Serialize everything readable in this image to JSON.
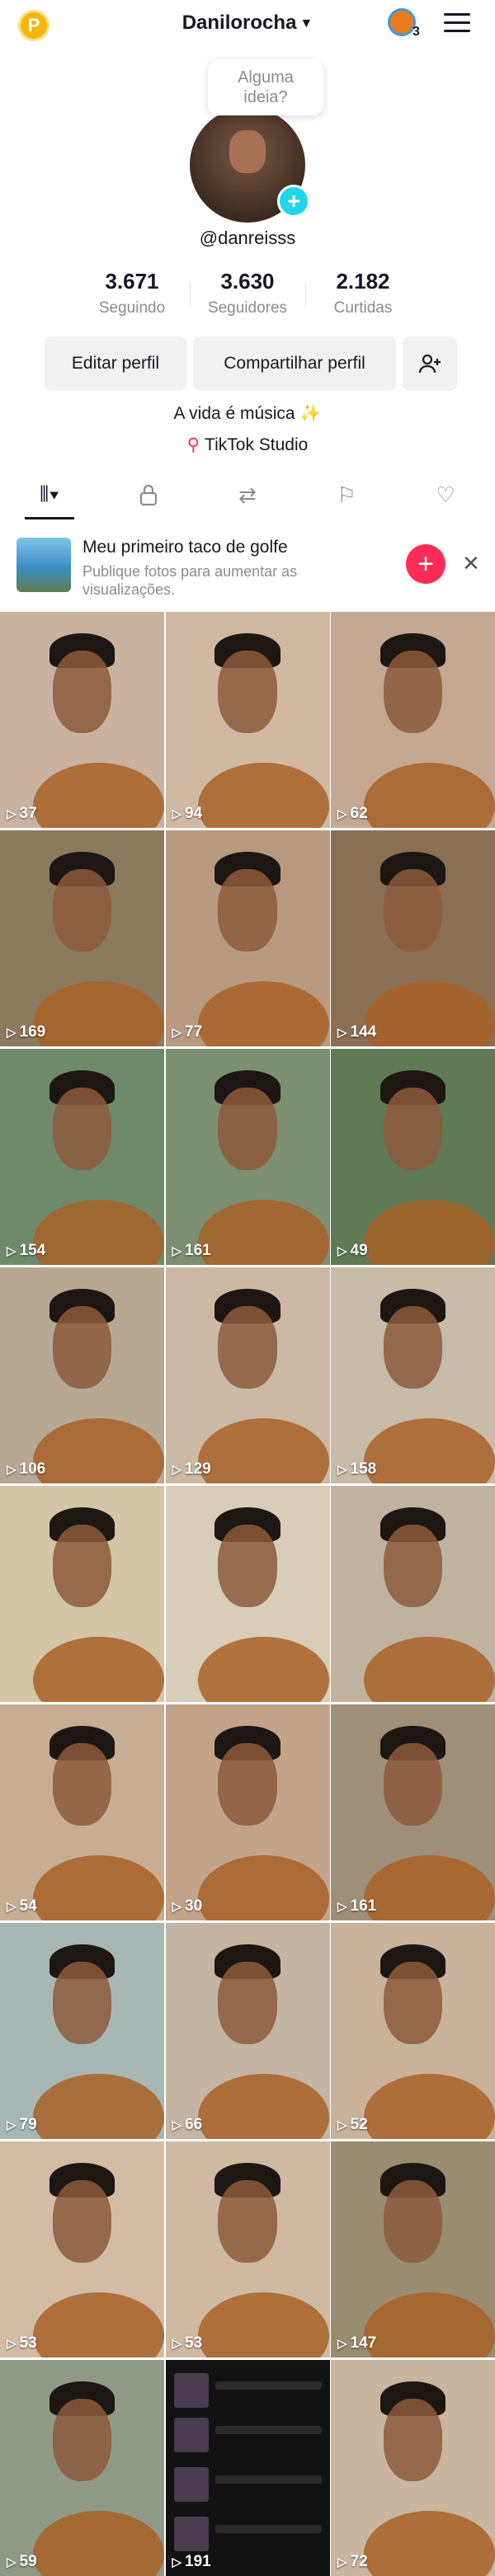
{
  "header": {
    "badge": "P",
    "title": "Danilorocha",
    "notification_count": "3"
  },
  "profile": {
    "tooltip": "Alguma ideia?",
    "handle": "@danreisss",
    "stats": [
      {
        "value": "3.671",
        "label": "Seguindo"
      },
      {
        "value": "3.630",
        "label": "Seguidores"
      },
      {
        "value": "2.182",
        "label": "Curtidas"
      }
    ],
    "edit_label": "Editar perfil",
    "share_label": "Compartilhar perfil",
    "bio": "A vida é música ✨",
    "studio_label": "TikTok Studio"
  },
  "tabs": [
    {
      "icon": "grid-icon",
      "active": true
    },
    {
      "icon": "lock-icon",
      "active": false
    },
    {
      "icon": "repost-icon",
      "active": false
    },
    {
      "icon": "bookmark-icon",
      "active": false
    },
    {
      "icon": "liked-icon",
      "active": false
    }
  ],
  "promo": {
    "title": "Meu primeiro taco de golfe",
    "subtitle": "Publique fotos para aumentar as visualizações."
  },
  "videos": [
    {
      "views": "37",
      "bg": "#c9b2a0"
    },
    {
      "views": "94",
      "bg": "#d1b8a3"
    },
    {
      "views": "62",
      "bg": "#c4a893"
    },
    {
      "views": "169",
      "bg": "#8c7a5e"
    },
    {
      "views": "77",
      "bg": "#b89a80"
    },
    {
      "views": "144",
      "bg": "#8a6f55"
    },
    {
      "views": "154",
      "bg": "#6f8a6a"
    },
    {
      "views": "161",
      "bg": "#7c8f70"
    },
    {
      "views": "49",
      "bg": "#5f7a55"
    },
    {
      "views": "106",
      "bg": "#b7a894"
    },
    {
      "views": "129",
      "bg": "#cbb9a5"
    },
    {
      "views": "158",
      "bg": "#c7bba9"
    },
    {
      "views": "",
      "bg": "#d4c4a8"
    },
    {
      "views": "",
      "bg": "#d8cdb8"
    },
    {
      "views": "",
      "bg": "#bfb3a0"
    },
    {
      "views": "54",
      "bg": "#c8ad95"
    },
    {
      "views": "30",
      "bg": "#c3a48b"
    },
    {
      "views": "161",
      "bg": "#9f8f79"
    },
    {
      "views": "79",
      "bg": "#a7b8b4"
    },
    {
      "views": "66",
      "bg": "#c4b4a3"
    },
    {
      "views": "52",
      "bg": "#c9b29c"
    },
    {
      "views": "53",
      "bg": "#d2bca6"
    },
    {
      "views": "53",
      "bg": "#d0b9a2"
    },
    {
      "views": "147",
      "bg": "#9a8c70"
    },
    {
      "views": "59",
      "bg": "#8f9a86"
    },
    {
      "views": "191",
      "bg": "#121212",
      "album": true
    },
    {
      "views": "72",
      "bg": "#c9b5a0"
    }
  ]
}
